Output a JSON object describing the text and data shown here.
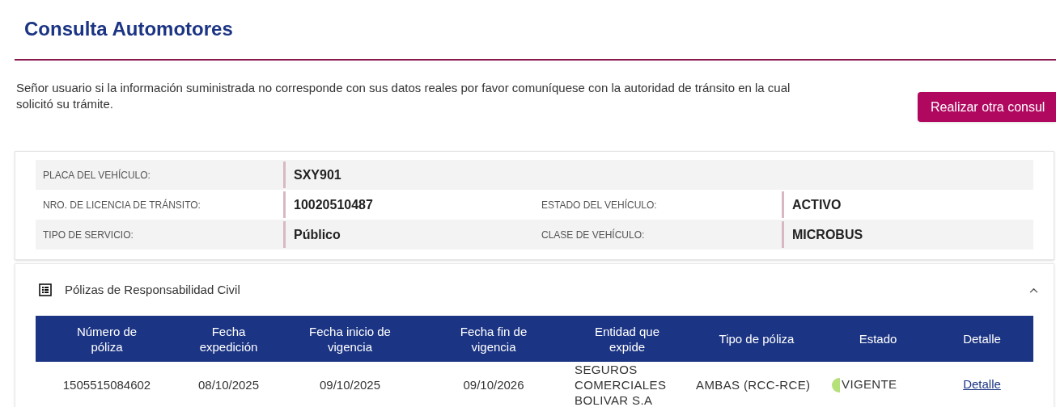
{
  "page_title": "Consulta Automotores",
  "notice": "Señor usuario si la información suministrada no corresponde con sus datos reales por favor comuníquese con la autoridad de tránsito en la cual solicitó su trámite.",
  "action_button": "Realizar otra consul",
  "vehicle_info": [
    {
      "cells": [
        {
          "label": "PLACA DEL VEHÍCULO:",
          "value": "SXY901"
        }
      ]
    },
    {
      "cells": [
        {
          "label": "NRO. DE LICENCIA DE TRÁNSITO:",
          "value": "10020510487"
        },
        {
          "label": "ESTADO DEL VEHÍCULO:",
          "value": "ACTIVO"
        }
      ]
    },
    {
      "cells": [
        {
          "label": "TIPO DE SERVICIO:",
          "value": "Público"
        },
        {
          "label": "CLASE DE VEHÍCULO:",
          "value": "MICROBUS"
        }
      ]
    }
  ],
  "policies": {
    "title": "Pólizas de Responsabilidad Civil",
    "expanded": true,
    "table": {
      "columns": [
        "Número de póliza",
        "Fecha expedición",
        "Fecha inicio de vigencia",
        "Fecha fin de vigencia",
        "Entidad que expide",
        "Tipo de póliza",
        "Estado",
        "Detalle"
      ],
      "rows": [
        {
          "cells": [
            "1505515084602",
            "08/10/2025",
            "09/10/2025",
            "09/10/2026",
            "SEGUROS COMERCIALES BOLIVAR S.A",
            "AMBAS (RCC-RCE)"
          ],
          "status": "VIGENTE",
          "color": "#b5e07a",
          "detail_link": "Detalle"
        }
      ]
    }
  }
}
